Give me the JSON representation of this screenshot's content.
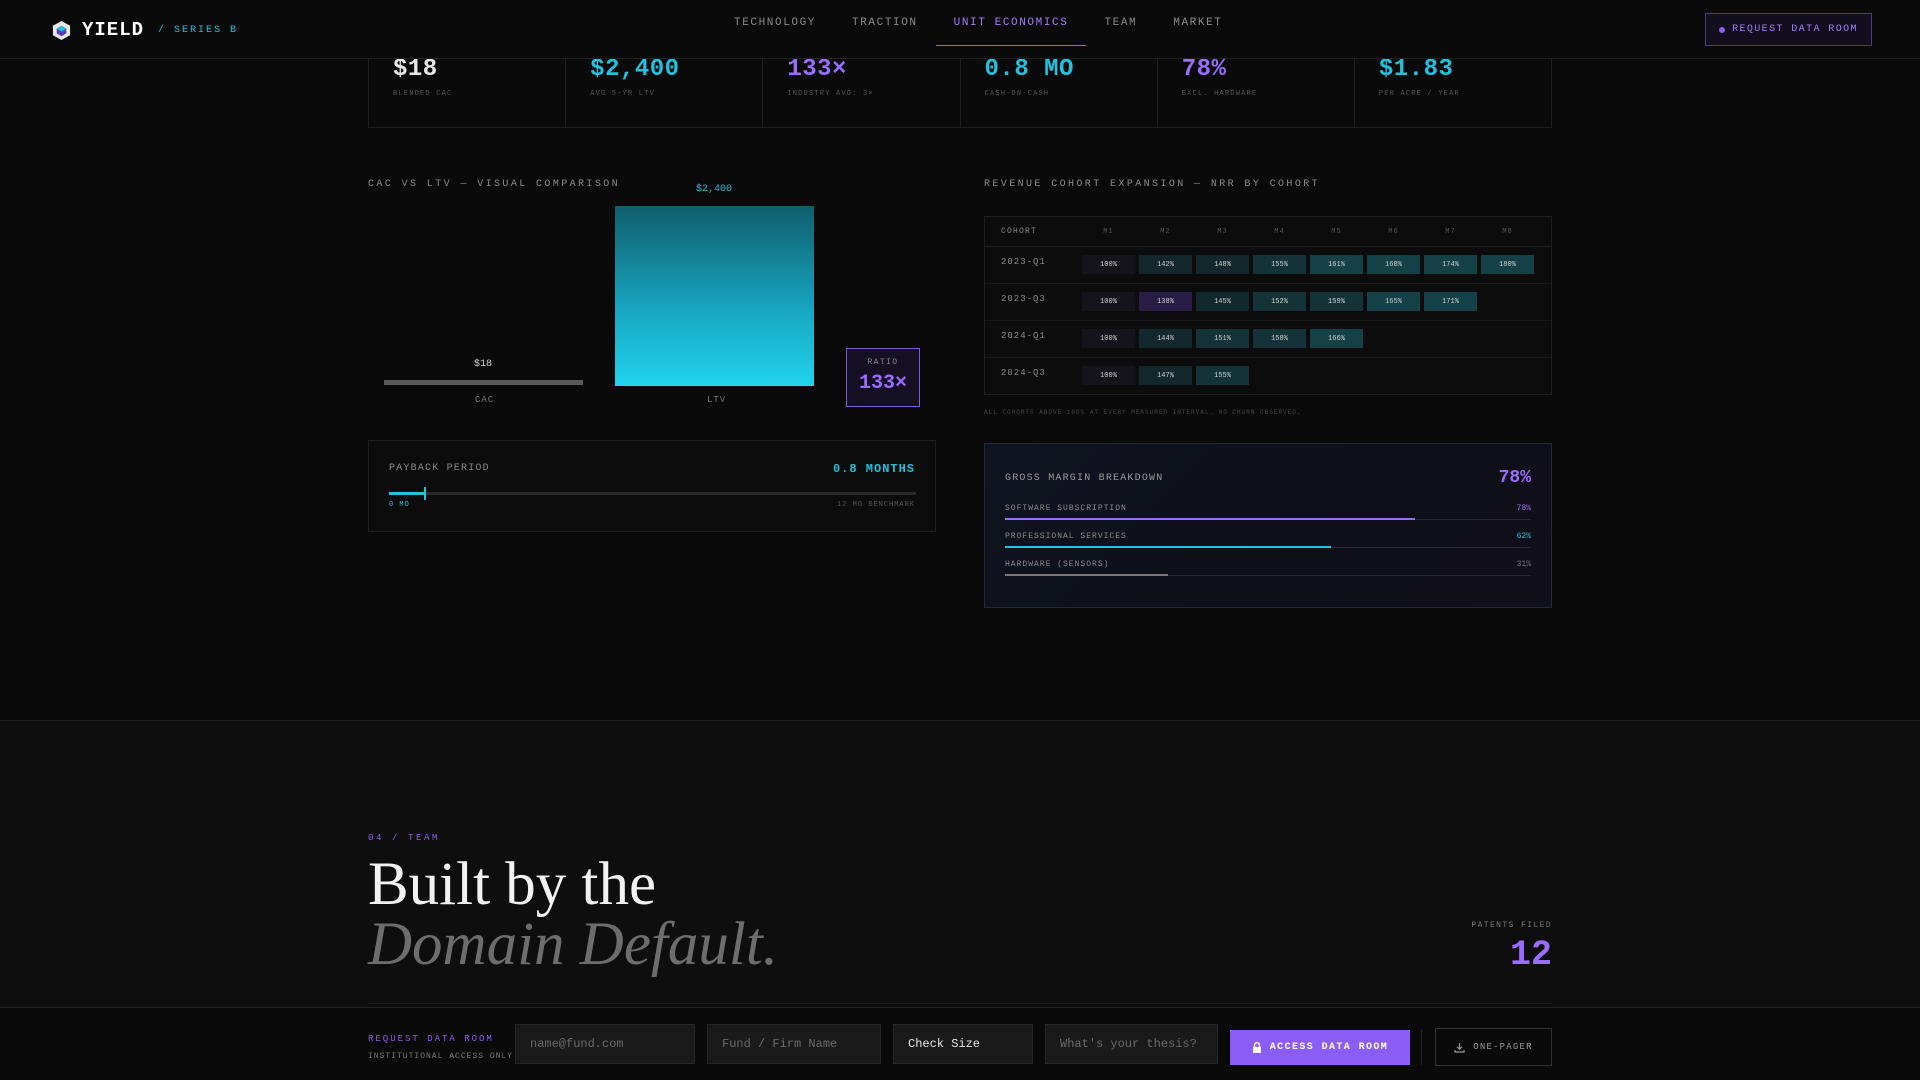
{
  "nav": {
    "brand": "YIELD",
    "series": "/ SERIES B",
    "links": [
      "TECHNOLOGY",
      "TRACTION",
      "UNIT ECONOMICS",
      "TEAM",
      "MARKET"
    ],
    "active": "UNIT ECONOMICS",
    "cta": "REQUEST DATA ROOM"
  },
  "metrics": [
    {
      "value": "$18",
      "label": "BLENDED CAC",
      "color": "#e8e8e8"
    },
    {
      "value": "$2,400",
      "label": "AVG 5-YR LTV",
      "color": "#22c1dd"
    },
    {
      "value": "133×",
      "label": "INDUSTRY AVG: 3×",
      "color": "#9b6dff"
    },
    {
      "value": "0.8 MO",
      "label": "CASH-ON-CASH",
      "color": "#22c1dd"
    },
    {
      "value": "78%",
      "label": "EXCL. HARDWARE",
      "color": "#9b6dff"
    },
    {
      "value": "$1.83",
      "label": "PER ACRE / YEAR",
      "color": "#22c1dd"
    }
  ],
  "comparison": {
    "title": "CAC VS LTV — VISUAL COMPARISON",
    "cac_value": "$18",
    "cac_label": "CAC",
    "ltv_value": "$2,400",
    "ltv_label": "LTV",
    "ratio_label": "RATIO",
    "ratio_value": "133×"
  },
  "payback": {
    "label": "PAYBACK PERIOD",
    "value": "0.8 MONTHS",
    "fraction": 0.0667,
    "min_label": "0 MO",
    "max_label": "12 MO BENCHMARK"
  },
  "cohort": {
    "title": "REVENUE COHORT EXPANSION — NRR BY COHORT",
    "header": "COHORT",
    "months": [
      "M1",
      "M2",
      "M3",
      "M4",
      "M5",
      "M6",
      "M7",
      "M8"
    ],
    "rows": [
      {
        "name": "2023-Q1",
        "cells": [
          "100%",
          "142%",
          "148%",
          "155%",
          "161%",
          "168%",
          "174%",
          "180%"
        ]
      },
      {
        "name": "2023-Q3",
        "cells": [
          "100%",
          "138%",
          "145%",
          "152%",
          "159%",
          "165%",
          "171%"
        ]
      },
      {
        "name": "2024-Q1",
        "cells": [
          "100%",
          "144%",
          "151%",
          "158%",
          "166%"
        ]
      },
      {
        "name": "2024-Q3",
        "cells": [
          "100%",
          "147%",
          "155%"
        ]
      }
    ],
    "note": "ALL COHORTS ABOVE 100% AT EVERY MEASURED INTERVAL. NO CHURN OBSERVED."
  },
  "gross_margin": {
    "title": "GROSS MARGIN BREAKDOWN",
    "value": "78%",
    "rows": [
      {
        "label": "SOFTWARE SUBSCRIPTION",
        "pct": "78%",
        "fraction": 0.78,
        "color": "#9b6dff"
      },
      {
        "label": "PROFESSIONAL SERVICES",
        "pct": "62%",
        "fraction": 0.62,
        "color": "#22c1dd"
      },
      {
        "label": "HARDWARE (SENSORS)",
        "pct": "31%",
        "fraction": 0.31,
        "color": "#777777"
      }
    ]
  },
  "team": {
    "tag": "04 / TEAM",
    "headline_1": "Built by the",
    "headline_2": "Domain Default.",
    "patents_label": "PATENTS FILED",
    "patents_value": "12"
  },
  "request_bar": {
    "title": "REQUEST DATA ROOM",
    "subtitle": "INSTITUTIONAL ACCESS ONLY",
    "email_placeholder": "name@fund.com",
    "firm_placeholder": "Fund / Firm Name",
    "check_size": "Check Size",
    "thesis_placeholder": "What's your thesis?",
    "access_button": "ACCESS DATA ROOM",
    "onepager_button": "ONE-PAGER"
  }
}
